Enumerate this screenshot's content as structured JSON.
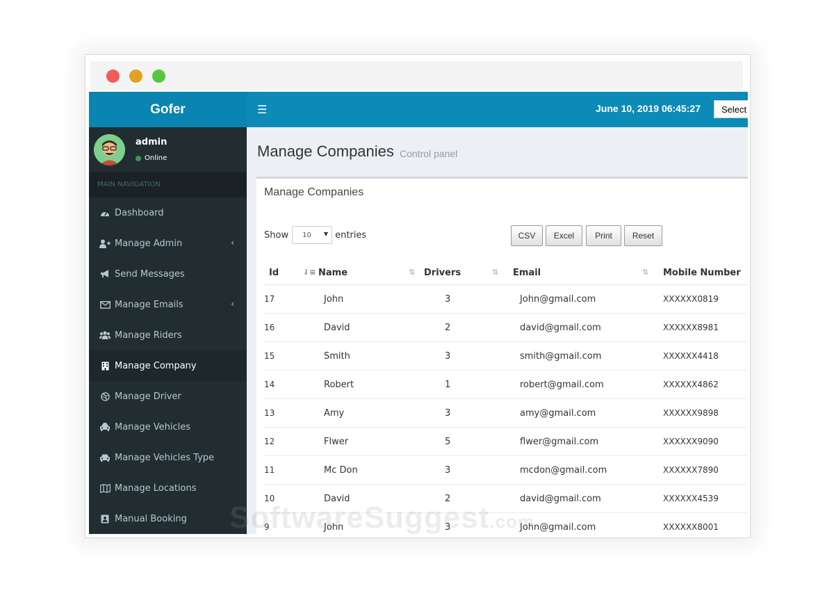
{
  "brand": "Gofer",
  "user": {
    "name": "admin",
    "status": "Online"
  },
  "sidebar": {
    "header": "MAIN NAVIGATION",
    "items": [
      {
        "label": "Dashboard",
        "icon": "tachometer-icon"
      },
      {
        "label": "Manage Admin",
        "icon": "user-plus-icon",
        "submenu": true
      },
      {
        "label": "Send Messages",
        "icon": "bullhorn-icon"
      },
      {
        "label": "Manage Emails",
        "icon": "envelope-icon",
        "submenu": true
      },
      {
        "label": "Manage Riders",
        "icon": "users-icon"
      },
      {
        "label": "Manage Company",
        "icon": "building-icon",
        "active": true
      },
      {
        "label": "Manage Driver",
        "icon": "dribbble-icon"
      },
      {
        "label": "Manage Vehicles",
        "icon": "taxi-icon"
      },
      {
        "label": "Manage Vehicles Type",
        "icon": "car-icon"
      },
      {
        "label": "Manage Locations",
        "icon": "map-icon"
      },
      {
        "label": "Manual Booking",
        "icon": "address-book-icon"
      }
    ]
  },
  "topbar": {
    "datetime": "June 10, 2019 06:45:27",
    "language_select": "Select"
  },
  "content": {
    "title": "Manage Companies",
    "subtitle": "Control panel"
  },
  "box": {
    "title": "Manage Companies",
    "show_label": "Show",
    "entries_value": "10",
    "entries_label": "entries",
    "buttons": [
      "CSV",
      "Excel",
      "Print",
      "Reset"
    ]
  },
  "table": {
    "columns": [
      "Id",
      "Name",
      "Drivers",
      "Email",
      "Mobile Number"
    ],
    "rows": [
      {
        "id": "17",
        "name": "John",
        "drivers": "3",
        "email": "John@gmail.com",
        "mobile": "XXXXXX0819"
      },
      {
        "id": "16",
        "name": "David",
        "drivers": "2",
        "email": "david@gmail.com",
        "mobile": "XXXXXX8981"
      },
      {
        "id": "15",
        "name": "Smith",
        "drivers": "3",
        "email": "smith@gmail.com",
        "mobile": "XXXXXX4418"
      },
      {
        "id": "14",
        "name": "Robert",
        "drivers": "1",
        "email": "robert@gmail.com",
        "mobile": "XXXXXX4862"
      },
      {
        "id": "13",
        "name": "Amy",
        "drivers": "3",
        "email": "amy@gmail.com",
        "mobile": "XXXXXX9898"
      },
      {
        "id": "12",
        "name": "Flwer",
        "drivers": "5",
        "email": "flwer@gmail.com",
        "mobile": "XXXXXX9090"
      },
      {
        "id": "11",
        "name": "Mc Don",
        "drivers": "3",
        "email": "mcdon@gmail.com",
        "mobile": "XXXXXX7890"
      },
      {
        "id": "10",
        "name": "David",
        "drivers": "2",
        "email": "david@gmail.com",
        "mobile": "XXXXXX4539"
      },
      {
        "id": "9",
        "name": "John",
        "drivers": "3",
        "email": "John@gmail.com",
        "mobile": "XXXXXX8001"
      }
    ]
  },
  "watermark": {
    "main": "SoftwareSuggest",
    "suffix": ".com"
  },
  "colors": {
    "topbar": "#0c8bb7",
    "sidebar": "#222d32",
    "logo_bg": "#0a84b0",
    "online": "#3c9a4d"
  }
}
